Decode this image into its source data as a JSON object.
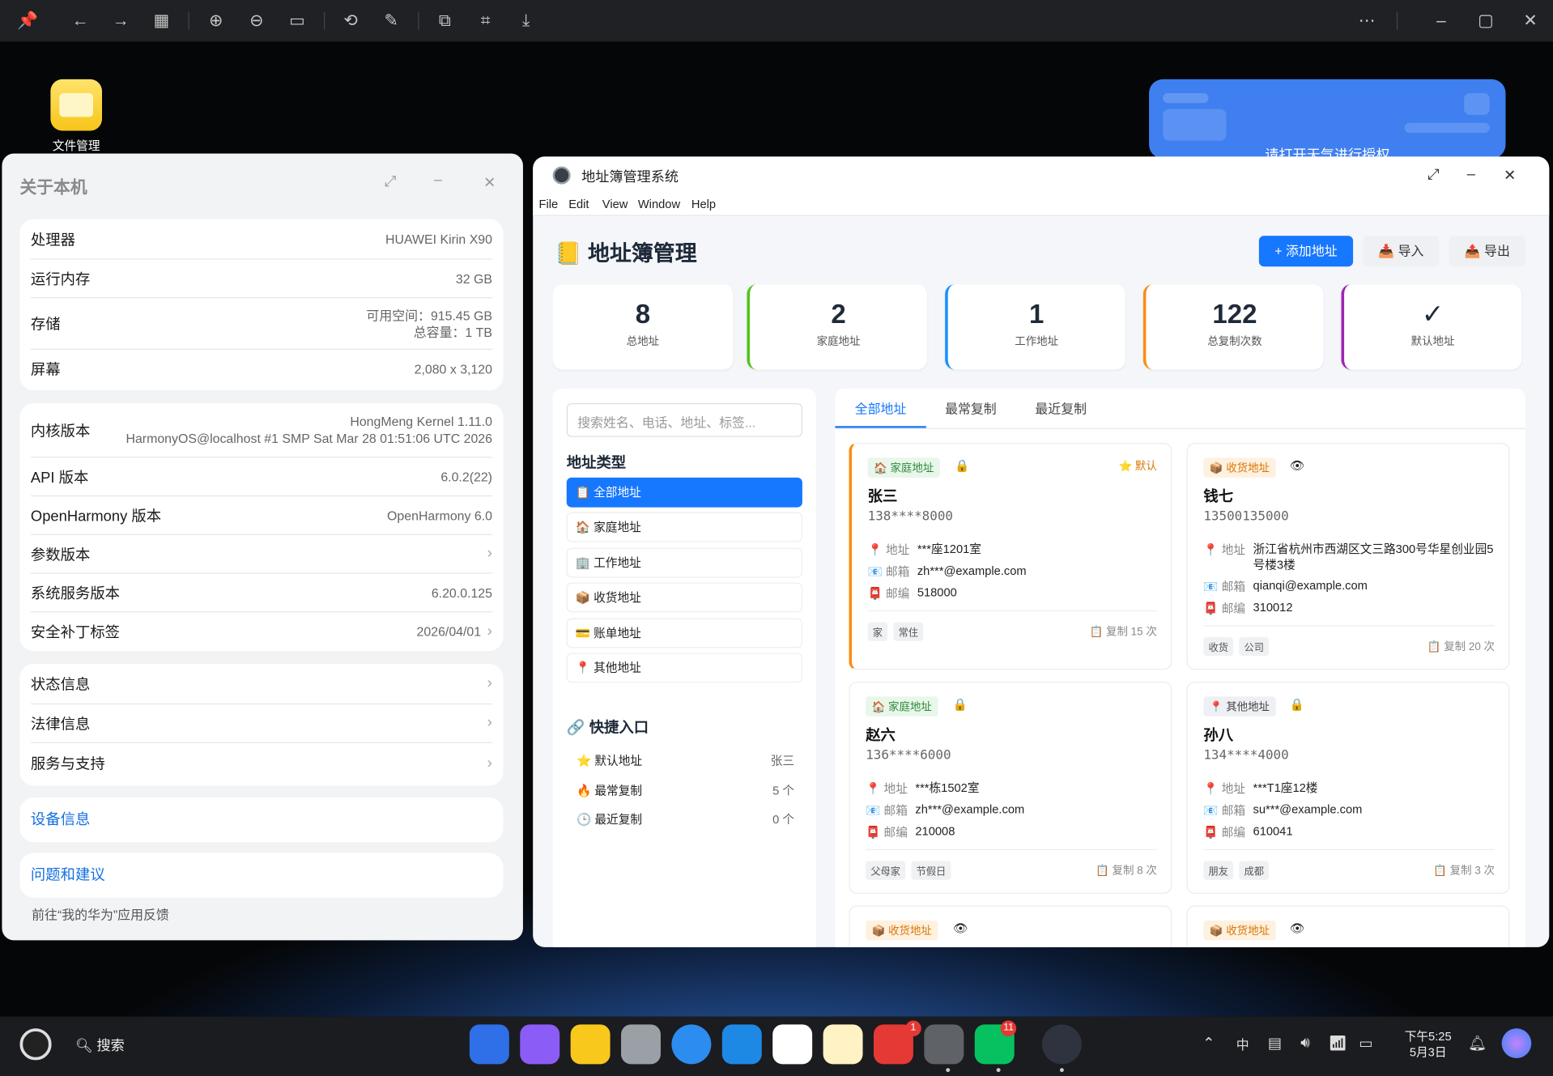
{
  "viewer_toolbar": {
    "icons": [
      "pin-icon",
      "back-icon",
      "forward-icon",
      "grid-icon",
      "zoom-in-icon",
      "zoom-out-icon",
      "actual-size-icon",
      "rotate-icon",
      "edit-icon",
      "translate-icon",
      "scan-icon",
      "save-icon",
      "more-icon",
      "minimize-icon",
      "maximize-icon",
      "close-icon"
    ]
  },
  "desktop": {
    "file_manager_label": "文件管理",
    "weather_text": "请打开天气进行授权"
  },
  "about": {
    "title": "关于本机",
    "group1": [
      {
        "key": "处理器",
        "value": "HUAWEI Kirin X90"
      },
      {
        "key": "运行内存",
        "value": "32 GB"
      },
      {
        "key": "存储",
        "value": "可用空间：915.45 GB",
        "value2": "总容量：1 TB"
      },
      {
        "key": "屏幕",
        "value": "2,080 x 3,120"
      }
    ],
    "group2": [
      {
        "key": "内核版本",
        "value": "HongMeng Kernel 1.11.0",
        "value2": "HarmonyOS@localhost #1 SMP Sat Mar 28 01:51:06 UTC 2026"
      },
      {
        "key": "API 版本",
        "value": "6.0.2(22)"
      },
      {
        "key": "OpenHarmony 版本",
        "value": "OpenHarmony 6.0"
      },
      {
        "key": "参数版本",
        "value": ""
      },
      {
        "key": "系统服务版本",
        "value": "6.20.0.125"
      },
      {
        "key": "安全补丁标签",
        "value": "2026/04/01"
      }
    ],
    "group3": [
      {
        "key": "状态信息"
      },
      {
        "key": "法律信息"
      },
      {
        "key": "服务与支持"
      }
    ],
    "device_info": "设备信息",
    "feedback": "问题和建议",
    "feedback_hint": "前往“我的华为”应用反馈"
  },
  "app": {
    "window_title": "地址簿管理系统",
    "menu": [
      "File",
      "Edit",
      "View",
      "Window",
      "Help"
    ],
    "header_title": "📒 地址簿管理",
    "buttons": {
      "add": "+ 添加地址",
      "import": "📥 导入",
      "export": "📤 导出"
    },
    "stats": [
      {
        "value": "8",
        "label": "总地址",
        "color": "#ffffff"
      },
      {
        "value": "2",
        "label": "家庭地址",
        "color": "#52c41a"
      },
      {
        "value": "1",
        "label": "工作地址",
        "color": "#1890ff"
      },
      {
        "value": "122",
        "label": "总复制次数",
        "color": "#fa8c16"
      },
      {
        "value": "✓",
        "label": "默认地址",
        "color": "#9c27b0"
      }
    ],
    "search_placeholder": "搜索姓名、电话、地址、标签...",
    "type_title": "地址类型",
    "types": [
      "📋 全部地址",
      "🏠 家庭地址",
      "🏢 工作地址",
      "📦 收货地址",
      "💳 账单地址",
      "📍 其他地址"
    ],
    "quick_title": "🔗 快捷入口",
    "quick": [
      {
        "label": "⭐ 默认地址",
        "count": "张三"
      },
      {
        "label": "🔥 最常复制",
        "count": "5 个"
      },
      {
        "label": "🕒 最近复制",
        "count": "0 个"
      }
    ],
    "tabs": [
      "全部地址",
      "最常复制",
      "最近复制"
    ],
    "cards": [
      {
        "badge": "🏠 家庭地址",
        "lock": "🔒",
        "default": "⭐ 默认",
        "name": "张三",
        "phone": "138****8000",
        "address_label": "📍 地址",
        "address": "***座1201室",
        "email_label": "📧 邮箱",
        "email": "zh***@example.com",
        "zip_label": "📮 邮编",
        "zip": "518000",
        "tags": [
          "家",
          "常住"
        ],
        "copies": "📋 复制 15 次"
      },
      {
        "badge": "📦 收货地址",
        "lock": "👁",
        "name": "钱七",
        "phone": "13500135000",
        "address_label": "📍 地址",
        "address": "浙江省杭州市西湖区文三路300号华星创业园5号楼3楼",
        "email_label": "📧 邮箱",
        "email": "qianqi@example.com",
        "zip_label": "📮 邮编",
        "zip": "310012",
        "tags": [
          "收货",
          "公司"
        ],
        "copies": "📋 复制 20 次"
      },
      {
        "badge": "🏠 家庭地址",
        "lock": "🔒",
        "name": "赵六",
        "phone": "136****6000",
        "address_label": "📍 地址",
        "address": "***栋1502室",
        "email_label": "📧 邮箱",
        "email": "zh***@example.com",
        "zip_label": "📮 邮编",
        "zip": "210008",
        "tags": [
          "父母家",
          "节假日"
        ],
        "copies": "📋 复制 8 次"
      },
      {
        "badge": "📍 其他地址",
        "lock": "🔒",
        "name": "孙八",
        "phone": "134****4000",
        "address_label": "📍 地址",
        "address": "***T1座12楼",
        "email_label": "📧 邮箱",
        "email": "su***@example.com",
        "zip_label": "📮 邮编",
        "zip": "610041",
        "tags": [
          "朋友",
          "成都"
        ],
        "copies": "📋 复制 3 次"
      },
      {
        "badge": "📦 收货地址",
        "lock": "👁"
      },
      {
        "badge": "📦 收货地址",
        "lock": "👁"
      }
    ]
  },
  "taskbar": {
    "search": "搜索",
    "appgallery_badge": "1",
    "wechat_badge": "11",
    "ime": "中",
    "time": "下午5:25",
    "date": "5月3日"
  }
}
